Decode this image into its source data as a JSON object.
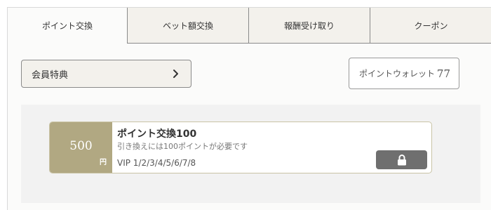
{
  "tabs": [
    {
      "label": "ポイント交換",
      "active": true
    },
    {
      "label": "ベット額交換",
      "active": false
    },
    {
      "label": "報酬受け取り",
      "active": false
    },
    {
      "label": "クーポン",
      "active": false
    }
  ],
  "member_benefits": {
    "label": "会員特典"
  },
  "wallet": {
    "label": "ポイントウォレット",
    "points": "77"
  },
  "coupon": {
    "amount": "500",
    "unit": "円",
    "title": "ポイント交換100",
    "description": "引き換えには100ポイントが必要です",
    "vip_levels": "VIP 1/2/3/4/5/6/7/8",
    "action_icon": "lock-icon",
    "accent_color": "#b1a882"
  }
}
